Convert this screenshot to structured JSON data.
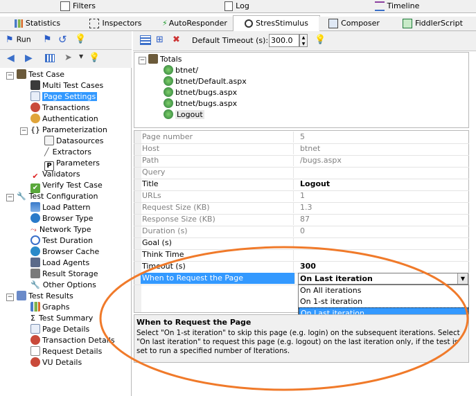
{
  "tabs_row1": [
    {
      "label": "Filters",
      "icon": "filters-icon"
    },
    {
      "label": "Log",
      "icon": "log-icon"
    },
    {
      "label": "Timeline",
      "icon": "timeline-icon"
    }
  ],
  "tabs_row2": [
    {
      "label": "Statistics",
      "icon": "statistics-icon"
    },
    {
      "label": "Inspectors",
      "icon": "inspectors-icon"
    },
    {
      "label": "AutoResponder",
      "icon": "autoresponder-icon"
    },
    {
      "label": "StresStimulus",
      "icon": "stresstimulus-icon"
    },
    {
      "label": "Composer",
      "icon": "composer-icon"
    },
    {
      "label": "FiddlerScript",
      "icon": "fiddlerscript-icon"
    }
  ],
  "left_toolbar": {
    "run_label": "Run"
  },
  "right_toolbar": {
    "timeout_label": "Default Timeout (s):",
    "timeout_value": "300.0"
  },
  "tree": {
    "test_case": "Test Case",
    "multi_test_cases": "Multi Test Cases",
    "page_settings": "Page Settings",
    "transactions": "Transactions",
    "authentication": "Authentication",
    "parameterization": "Parameterization",
    "datasources": "Datasources",
    "extractors": "Extractors",
    "parameters": "Parameters",
    "validators": "Validators",
    "verify_test_case": "Verify Test Case",
    "test_configuration": "Test Configuration",
    "load_pattern": "Load Pattern",
    "browser_type": "Browser Type",
    "network_type": "Network Type",
    "test_duration": "Test Duration",
    "browser_cache": "Browser Cache",
    "load_agents": "Load Agents",
    "result_storage": "Result Storage",
    "other_options": "Other Options",
    "test_results": "Test Results",
    "graphs": "Graphs",
    "test_summary": "Test Summary",
    "page_details": "Page Details",
    "transaction_details": "Transaction Details",
    "request_details": "Request Details",
    "vu_details": "VU Details"
  },
  "pages_tree": {
    "root": "Totals",
    "items": [
      "btnet/",
      "btnet/Default.aspx",
      "btnet/bugs.aspx",
      "btnet/bugs.aspx",
      "Logout"
    ]
  },
  "properties": [
    {
      "name": "Page number",
      "value": "5"
    },
    {
      "name": "Host",
      "value": "btnet"
    },
    {
      "name": "Path",
      "value": "/bugs.aspx"
    },
    {
      "name": "Query",
      "value": ""
    },
    {
      "name": "Title",
      "value": "Logout"
    },
    {
      "name": "URLs",
      "value": "1"
    },
    {
      "name": "Request Size (KB)",
      "value": "1.3"
    },
    {
      "name": "Response Size (KB)",
      "value": "87"
    },
    {
      "name": "Duration (s)",
      "value": "0"
    },
    {
      "name": "Goal (s)",
      "value": ""
    },
    {
      "name": "Think Time",
      "value": ""
    },
    {
      "name": "Timeout (s)",
      "value": "300"
    },
    {
      "name": "When to Request the Page",
      "value": "On Last iteration"
    }
  ],
  "dropdown_options": [
    "On All iterations",
    "On 1-st iteration",
    "On Last iteration"
  ],
  "help": {
    "title": "When to Request the Page",
    "text": "Select \"On 1-st iteration\" to skip this page (e.g. login) on the subsequent iterations. Select \"On last iteration\" to request this page (e.g. logout) on the last iteration only, if the test is set to run a specified number of Iterations."
  },
  "colors": {
    "selection": "#3399ff",
    "annotation_ellipse": "#f07a2a",
    "active_row": "#3399ff"
  }
}
